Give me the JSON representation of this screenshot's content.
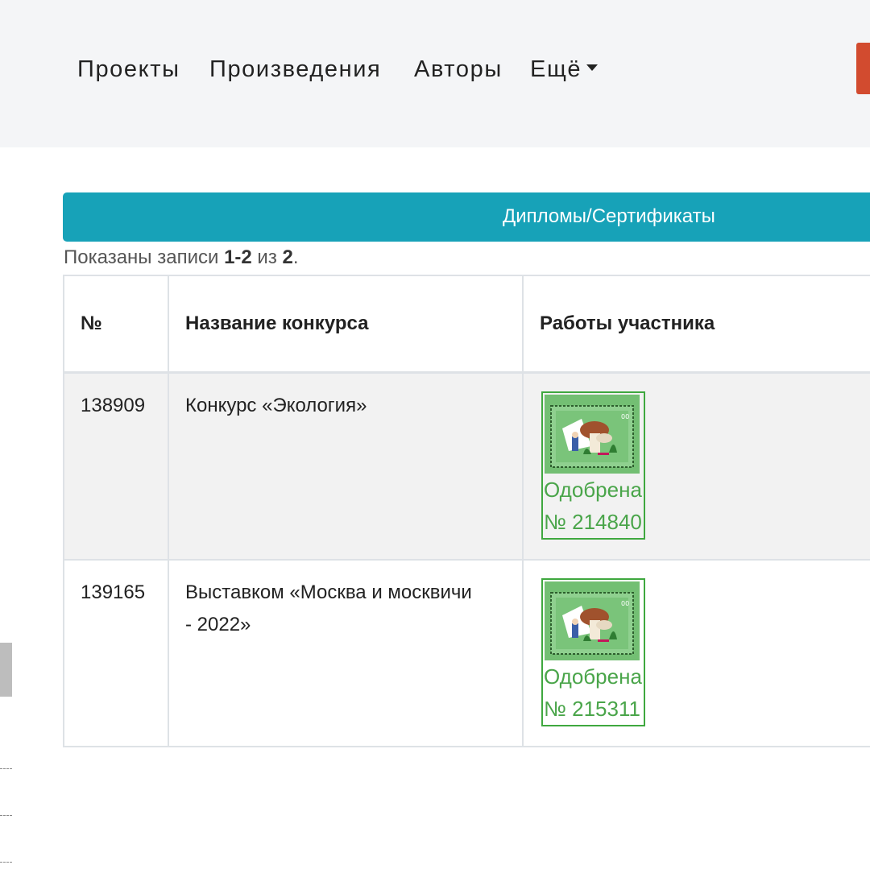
{
  "nav": {
    "items": [
      "Проекты",
      "Произведения",
      "Авторы",
      "Ещё"
    ]
  },
  "section": {
    "title": "Дипломы/Сертификаты"
  },
  "summary": {
    "prefix": "Показаны записи",
    "range": "1-2",
    "of": "из",
    "total": "2",
    "end": "."
  },
  "table": {
    "headers": [
      "№",
      "Название конкурса",
      "Работы участника"
    ],
    "rows": [
      {
        "id": "138909",
        "contest": "Конкурс «Экология»",
        "status": "Одобрена",
        "work_number": "№ 214840"
      },
      {
        "id": "139165",
        "contest": "Выставком «Москва и москвичи - 2022»",
        "status": "Одобрена",
        "work_number": "№ 215311"
      }
    ]
  },
  "colors": {
    "navbar_bg": "#f4f5f7",
    "section_bar": "#17a2b8",
    "accent_button": "#d24b2f",
    "approved_green": "#4aa54a"
  },
  "icons": {
    "more_caret": "caret-down-icon",
    "work_thumbnail": "stamp-thumbnail"
  }
}
